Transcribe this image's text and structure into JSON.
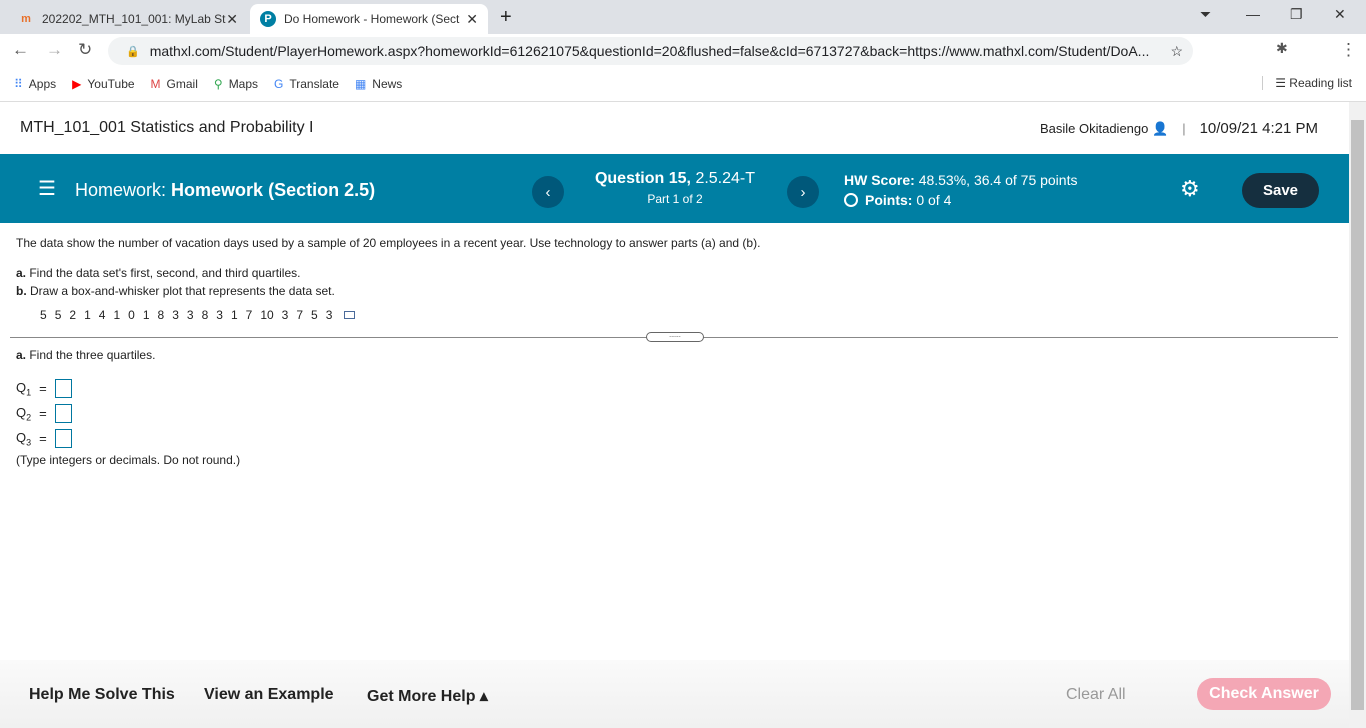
{
  "browser": {
    "tabs": [
      {
        "title": "202202_MTH_101_001: MyLab St",
        "favicon": "mylab-icon"
      },
      {
        "title": "Do Homework - Homework (Sect",
        "favicon": "pearson-icon"
      }
    ],
    "url": "mathxl.com/Student/PlayerHomework.aspx?homeworkId=612621075&questionId=20&flushed=false&cId=6713727&back=https://www.mathxl.com/Student/DoA...",
    "bookmarks": [
      "Apps",
      "YouTube",
      "Gmail",
      "Maps",
      "Translate",
      "News"
    ],
    "reading_list": "Reading list"
  },
  "header": {
    "course": "MTH_101_001 Statistics and Probability I",
    "user": "Basile Okitadiengo",
    "datetime": "10/09/21 4:21 PM"
  },
  "hwbar": {
    "label": "Homework:",
    "title": "Homework (Section 2.5)",
    "question_label": "Question 15,",
    "question_id": "2.5.24-T",
    "part": "Part 1 of 2",
    "score_label": "HW Score:",
    "score": "48.53%, 36.4 of 75 points",
    "points_label": "Points:",
    "points": "0 of 4",
    "save": "Save",
    "accent": "#007fa3"
  },
  "question": {
    "intro": "The data show the number of vacation days used by a sample of 20 employees in a recent year. Use technology to answer parts (a) and (b).",
    "a_label": "a.",
    "a_text": " Find the data set's first, second, and third quartiles.",
    "b_label": "b.",
    "b_text": " Draw a box-and-whisker plot that represents the data set.",
    "data": [
      "5",
      "5",
      "2",
      "1",
      "4",
      "1",
      "0",
      "1",
      "8",
      "3",
      "3",
      "8",
      "3",
      "1",
      "7",
      "10",
      "3",
      "7",
      "5",
      "3"
    ],
    "part_label": "a.",
    "part_text": " Find the three quartiles.",
    "quartiles": [
      {
        "q": "Q",
        "sub": "1",
        "value": ""
      },
      {
        "q": "Q",
        "sub": "2",
        "value": ""
      },
      {
        "q": "Q",
        "sub": "3",
        "value": ""
      }
    ],
    "hint": "(Type integers or decimals. Do not round.)"
  },
  "footer": {
    "help": "Help Me Solve This",
    "example": "View an Example",
    "more": "Get More Help ▴",
    "clear": "Clear All",
    "check": "Check Answer"
  }
}
